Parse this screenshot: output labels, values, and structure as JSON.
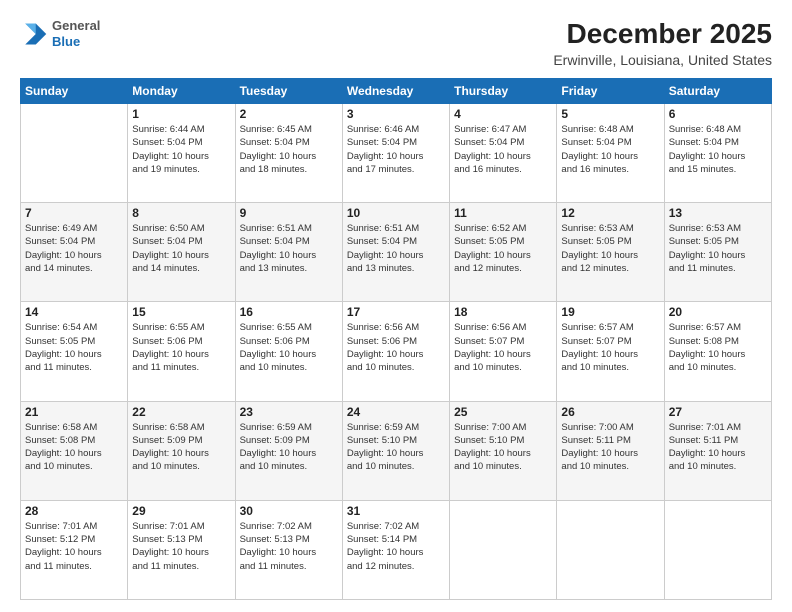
{
  "header": {
    "logo_general": "General",
    "logo_blue": "Blue",
    "title": "December 2025",
    "subtitle": "Erwinville, Louisiana, United States"
  },
  "calendar": {
    "days_of_week": [
      "Sunday",
      "Monday",
      "Tuesday",
      "Wednesday",
      "Thursday",
      "Friday",
      "Saturday"
    ],
    "weeks": [
      [
        {
          "day": "",
          "info": ""
        },
        {
          "day": "1",
          "info": "Sunrise: 6:44 AM\nSunset: 5:04 PM\nDaylight: 10 hours\nand 19 minutes."
        },
        {
          "day": "2",
          "info": "Sunrise: 6:45 AM\nSunset: 5:04 PM\nDaylight: 10 hours\nand 18 minutes."
        },
        {
          "day": "3",
          "info": "Sunrise: 6:46 AM\nSunset: 5:04 PM\nDaylight: 10 hours\nand 17 minutes."
        },
        {
          "day": "4",
          "info": "Sunrise: 6:47 AM\nSunset: 5:04 PM\nDaylight: 10 hours\nand 16 minutes."
        },
        {
          "day": "5",
          "info": "Sunrise: 6:48 AM\nSunset: 5:04 PM\nDaylight: 10 hours\nand 16 minutes."
        },
        {
          "day": "6",
          "info": "Sunrise: 6:48 AM\nSunset: 5:04 PM\nDaylight: 10 hours\nand 15 minutes."
        }
      ],
      [
        {
          "day": "7",
          "info": "Sunrise: 6:49 AM\nSunset: 5:04 PM\nDaylight: 10 hours\nand 14 minutes."
        },
        {
          "day": "8",
          "info": "Sunrise: 6:50 AM\nSunset: 5:04 PM\nDaylight: 10 hours\nand 14 minutes."
        },
        {
          "day": "9",
          "info": "Sunrise: 6:51 AM\nSunset: 5:04 PM\nDaylight: 10 hours\nand 13 minutes."
        },
        {
          "day": "10",
          "info": "Sunrise: 6:51 AM\nSunset: 5:04 PM\nDaylight: 10 hours\nand 13 minutes."
        },
        {
          "day": "11",
          "info": "Sunrise: 6:52 AM\nSunset: 5:05 PM\nDaylight: 10 hours\nand 12 minutes."
        },
        {
          "day": "12",
          "info": "Sunrise: 6:53 AM\nSunset: 5:05 PM\nDaylight: 10 hours\nand 12 minutes."
        },
        {
          "day": "13",
          "info": "Sunrise: 6:53 AM\nSunset: 5:05 PM\nDaylight: 10 hours\nand 11 minutes."
        }
      ],
      [
        {
          "day": "14",
          "info": "Sunrise: 6:54 AM\nSunset: 5:05 PM\nDaylight: 10 hours\nand 11 minutes."
        },
        {
          "day": "15",
          "info": "Sunrise: 6:55 AM\nSunset: 5:06 PM\nDaylight: 10 hours\nand 11 minutes."
        },
        {
          "day": "16",
          "info": "Sunrise: 6:55 AM\nSunset: 5:06 PM\nDaylight: 10 hours\nand 10 minutes."
        },
        {
          "day": "17",
          "info": "Sunrise: 6:56 AM\nSunset: 5:06 PM\nDaylight: 10 hours\nand 10 minutes."
        },
        {
          "day": "18",
          "info": "Sunrise: 6:56 AM\nSunset: 5:07 PM\nDaylight: 10 hours\nand 10 minutes."
        },
        {
          "day": "19",
          "info": "Sunrise: 6:57 AM\nSunset: 5:07 PM\nDaylight: 10 hours\nand 10 minutes."
        },
        {
          "day": "20",
          "info": "Sunrise: 6:57 AM\nSunset: 5:08 PM\nDaylight: 10 hours\nand 10 minutes."
        }
      ],
      [
        {
          "day": "21",
          "info": "Sunrise: 6:58 AM\nSunset: 5:08 PM\nDaylight: 10 hours\nand 10 minutes."
        },
        {
          "day": "22",
          "info": "Sunrise: 6:58 AM\nSunset: 5:09 PM\nDaylight: 10 hours\nand 10 minutes."
        },
        {
          "day": "23",
          "info": "Sunrise: 6:59 AM\nSunset: 5:09 PM\nDaylight: 10 hours\nand 10 minutes."
        },
        {
          "day": "24",
          "info": "Sunrise: 6:59 AM\nSunset: 5:10 PM\nDaylight: 10 hours\nand 10 minutes."
        },
        {
          "day": "25",
          "info": "Sunrise: 7:00 AM\nSunset: 5:10 PM\nDaylight: 10 hours\nand 10 minutes."
        },
        {
          "day": "26",
          "info": "Sunrise: 7:00 AM\nSunset: 5:11 PM\nDaylight: 10 hours\nand 10 minutes."
        },
        {
          "day": "27",
          "info": "Sunrise: 7:01 AM\nSunset: 5:11 PM\nDaylight: 10 hours\nand 10 minutes."
        }
      ],
      [
        {
          "day": "28",
          "info": "Sunrise: 7:01 AM\nSunset: 5:12 PM\nDaylight: 10 hours\nand 11 minutes."
        },
        {
          "day": "29",
          "info": "Sunrise: 7:01 AM\nSunset: 5:13 PM\nDaylight: 10 hours\nand 11 minutes."
        },
        {
          "day": "30",
          "info": "Sunrise: 7:02 AM\nSunset: 5:13 PM\nDaylight: 10 hours\nand 11 minutes."
        },
        {
          "day": "31",
          "info": "Sunrise: 7:02 AM\nSunset: 5:14 PM\nDaylight: 10 hours\nand 12 minutes."
        },
        {
          "day": "",
          "info": ""
        },
        {
          "day": "",
          "info": ""
        },
        {
          "day": "",
          "info": ""
        }
      ]
    ]
  }
}
